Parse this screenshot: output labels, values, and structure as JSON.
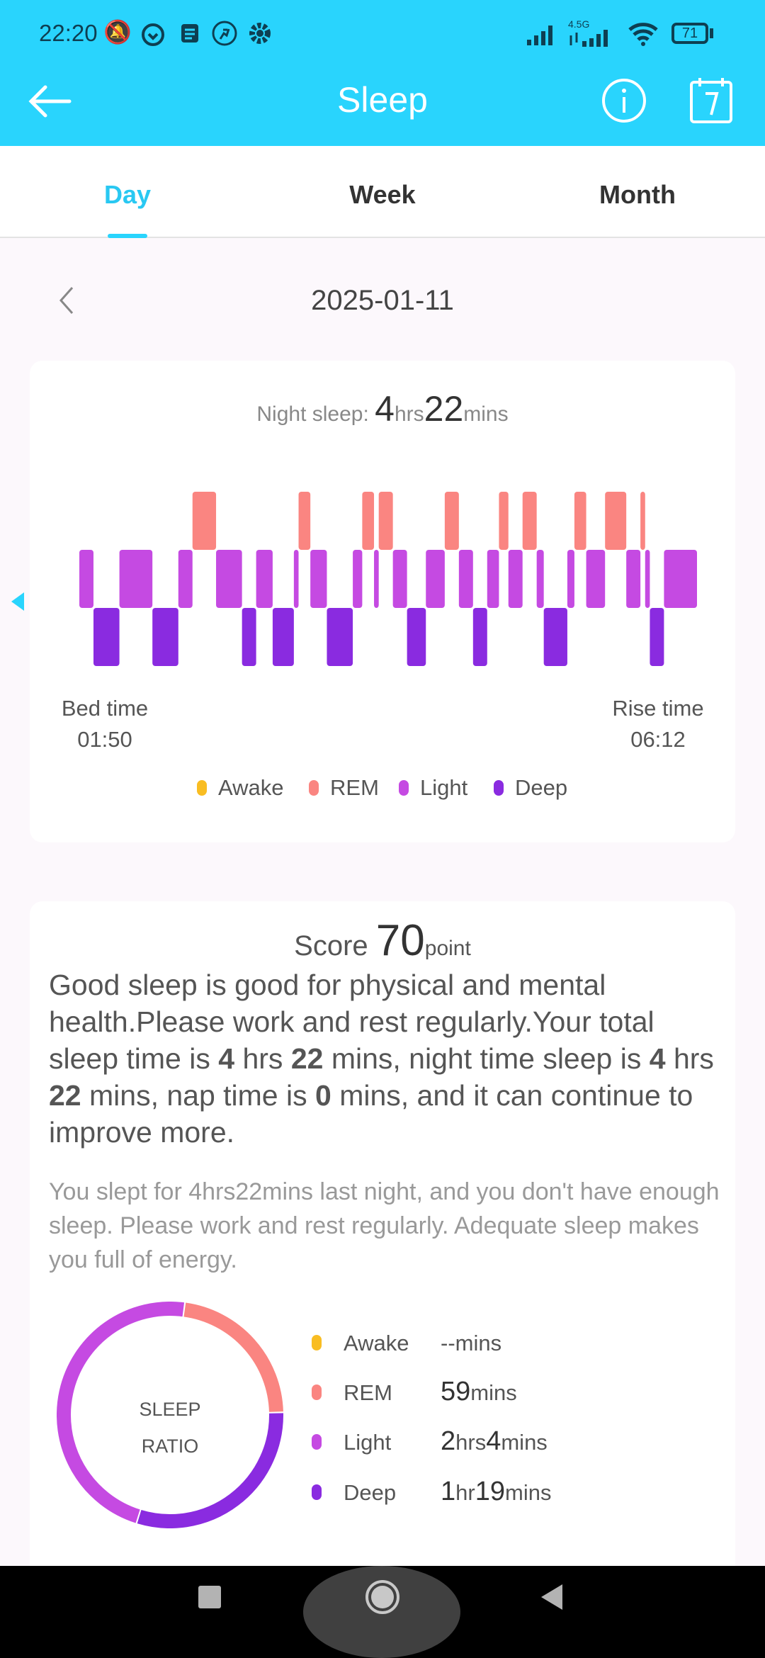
{
  "status_bar": {
    "time": "22:20",
    "network": "4.5G",
    "battery": "71"
  },
  "header": {
    "title": "Sleep"
  },
  "tabs": [
    {
      "label": "Day",
      "active": true
    },
    {
      "label": "Week"
    },
    {
      "label": "Month"
    }
  ],
  "date": "2025-01-11",
  "night_sleep": {
    "label": "Night sleep:",
    "hours": "4",
    "hrs_unit": "hrs",
    "minutes": "22",
    "mins_unit": "mins"
  },
  "bed_time": {
    "label": "Bed time",
    "value": "01:50"
  },
  "rise_time": {
    "label": "Rise time",
    "value": "06:12"
  },
  "colors": {
    "accent": "#29d4fd",
    "awake": "#f9bd22",
    "rem": "#fa8581",
    "light": "#c54ae2",
    "deep": "#8a2be0"
  },
  "legend": [
    "Awake",
    "REM",
    "Light",
    "Deep"
  ],
  "chart_data": {
    "type": "timeline",
    "x_range": [
      "01:50",
      "06:12"
    ],
    "stages": [
      "REM",
      "Light",
      "Deep"
    ],
    "segments": [
      [
        "Light",
        "01:50",
        "01:56"
      ],
      [
        "Deep",
        "01:56",
        "02:07"
      ],
      [
        "Light",
        "02:07",
        "02:21"
      ],
      [
        "Deep",
        "02:21",
        "02:32"
      ],
      [
        "Light",
        "02:32",
        "02:38"
      ],
      [
        "REM",
        "02:38",
        "02:48"
      ],
      [
        "Light",
        "02:48",
        "02:59"
      ],
      [
        "Deep",
        "02:59",
        "03:05"
      ],
      [
        "Light",
        "03:05",
        "03:12"
      ],
      [
        "Deep",
        "03:12",
        "03:21"
      ],
      [
        "Light",
        "03:21",
        "03:23"
      ],
      [
        "REM",
        "03:23",
        "03:28"
      ],
      [
        "Light",
        "03:28",
        "03:35"
      ],
      [
        "Deep",
        "03:35",
        "03:46"
      ],
      [
        "Light",
        "03:46",
        "03:50"
      ],
      [
        "REM",
        "03:50",
        "03:55"
      ],
      [
        "Light",
        "03:55",
        "03:57"
      ],
      [
        "REM",
        "03:57",
        "04:03"
      ],
      [
        "Light",
        "04:03",
        "04:09"
      ],
      [
        "Deep",
        "04:09",
        "04:17"
      ],
      [
        "Light",
        "04:17",
        "04:25"
      ],
      [
        "REM",
        "04:25",
        "04:31"
      ],
      [
        "Light",
        "04:31",
        "04:37"
      ],
      [
        "Deep",
        "04:37",
        "04:43"
      ],
      [
        "Light",
        "04:43",
        "04:48"
      ],
      [
        "REM",
        "04:48",
        "04:52"
      ],
      [
        "Light",
        "04:52",
        "04:58"
      ],
      [
        "REM",
        "04:58",
        "05:04"
      ],
      [
        "Light",
        "05:04",
        "05:07"
      ],
      [
        "Deep",
        "05:07",
        "05:17"
      ],
      [
        "Light",
        "05:17",
        "05:20"
      ],
      [
        "REM",
        "05:20",
        "05:25"
      ],
      [
        "Light",
        "05:25",
        "05:33"
      ],
      [
        "REM",
        "05:33",
        "05:42"
      ],
      [
        "Light",
        "05:42",
        "05:48"
      ],
      [
        "REM",
        "05:48",
        "05:50"
      ],
      [
        "Light",
        "05:50",
        "05:52"
      ],
      [
        "Deep",
        "05:52",
        "05:58"
      ],
      [
        "Light",
        "05:58",
        "06:12"
      ]
    ]
  },
  "score": {
    "label": "Score",
    "value": "70",
    "unit": "point"
  },
  "summary": [
    {
      "t": "Good sleep is good for physical and mental health.Please work and rest regularly.Your total sleep time is "
    },
    {
      "t": "4",
      "b": true
    },
    {
      "t": " hrs "
    },
    {
      "t": "22",
      "b": true
    },
    {
      "t": " mins, night time sleep is "
    },
    {
      "t": "4",
      "b": true
    },
    {
      "t": " hrs "
    },
    {
      "t": "22",
      "b": true
    },
    {
      "t": " mins, nap time is "
    },
    {
      "t": "0",
      "b": true
    },
    {
      "t": " mins, and it can continue to improve more."
    }
  ],
  "advice": "You slept for 4hrs22mins last night, and you don't have enough sleep. Please work and rest regularly. Adequate sleep makes you full of energy.",
  "ratio": {
    "center": [
      "SLEEP",
      "RATIO"
    ],
    "items": [
      {
        "label": "Awake",
        "value": "--",
        "unit": "mins",
        "minutes": 0
      },
      {
        "label": "REM",
        "v1": "59",
        "u1": "mins",
        "minutes": 59
      },
      {
        "label": "Light",
        "v1": "2",
        "u1": "hrs",
        "v2": "4",
        "u2": "mins",
        "minutes": 124
      },
      {
        "label": "Deep",
        "v1": "1",
        "u1": "hr",
        "v2": "19",
        "u2": "mins",
        "minutes": 79
      }
    ]
  }
}
